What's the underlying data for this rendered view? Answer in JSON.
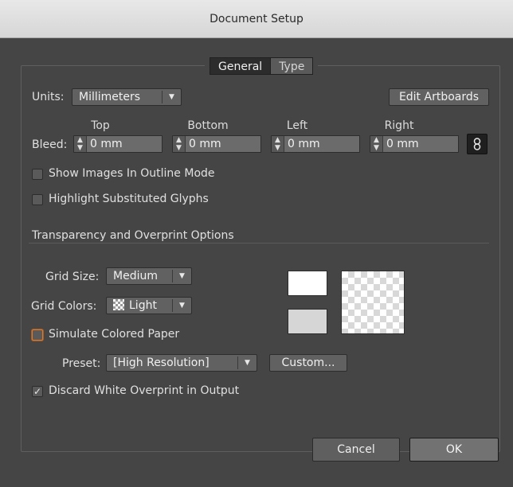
{
  "window": {
    "title": "Document Setup"
  },
  "tabs": [
    {
      "label": "General",
      "active": true
    },
    {
      "label": "Type",
      "active": false
    }
  ],
  "units": {
    "label": "Units:",
    "value": "Millimeters"
  },
  "edit_artboards": "Edit Artboards",
  "bleed": {
    "label": "Bleed:",
    "top": {
      "header": "Top",
      "value": "0 mm"
    },
    "bottom": {
      "header": "Bottom",
      "value": "0 mm"
    },
    "left": {
      "header": "Left",
      "value": "0 mm"
    },
    "right": {
      "header": "Right",
      "value": "0 mm"
    },
    "link_icon": "chain-link-icon"
  },
  "options": {
    "show_images_outline": {
      "label": "Show Images In Outline Mode",
      "checked": false
    },
    "highlight_glyphs": {
      "label": "Highlight Substituted Glyphs",
      "checked": false
    }
  },
  "transparency": {
    "heading": "Transparency and Overprint Options",
    "grid_size": {
      "label": "Grid Size:",
      "value": "Medium"
    },
    "grid_colors": {
      "label": "Grid Colors:",
      "value": "Light"
    },
    "simulate_paper": {
      "label": "Simulate Colored Paper",
      "checked": false
    },
    "preset": {
      "label": "Preset:",
      "value": "[High Resolution]"
    },
    "custom_button": "Custom...",
    "discard_white": {
      "label": "Discard White Overprint in Output",
      "checked": true
    },
    "swatch_colors": {
      "top": "#ffffff",
      "bottom": "#d6d6d6"
    }
  },
  "footer": {
    "cancel": "Cancel",
    "ok": "OK"
  },
  "colors": {
    "accent_focus": "#d97a30",
    "dialog_bg": "#454545"
  }
}
